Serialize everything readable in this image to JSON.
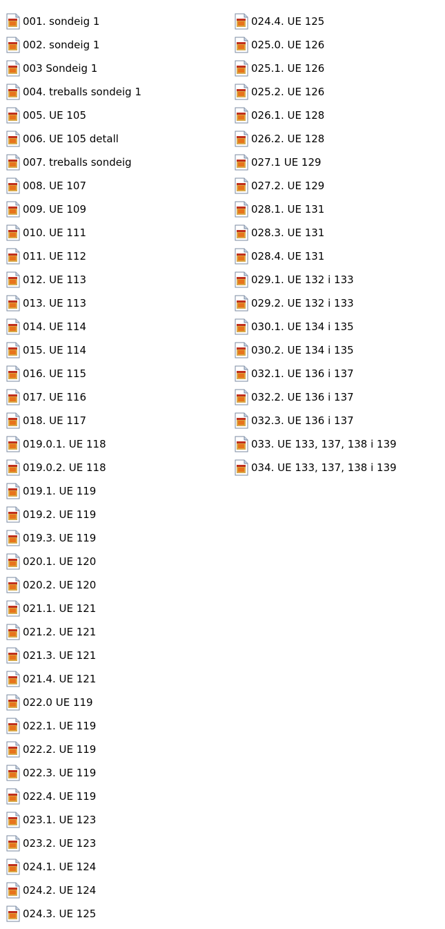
{
  "file_icon": "presentation-file-icon",
  "colors": {
    "background": "#ffffff",
    "text": "#000000",
    "icon_page": "#ffffff",
    "icon_border": "#7a8aa0",
    "icon_fold": "#c8d4e4",
    "icon_orange": "#e8741c",
    "icon_red": "#c0301c",
    "icon_tan": "#d8a848"
  },
  "columns": [
    {
      "items": [
        "001. sondeig 1",
        "002. sondeig 1",
        "003 Sondeig 1",
        "004. treballs sondeig 1",
        "005. UE 105",
        "006. UE 105 detall",
        "007. treballs sondeig",
        "008. UE 107",
        "009. UE 109",
        "010. UE 111",
        "011. UE 112",
        "012. UE 113",
        "013. UE 113",
        "014. UE 114",
        "015. UE 114",
        "016. UE 115",
        "017. UE 116",
        "018. UE 117",
        "019.0.1. UE 118",
        "019.0.2. UE 118",
        "019.1. UE 119",
        "019.2. UE 119",
        "019.3. UE 119",
        "020.1. UE 120",
        "020.2. UE 120",
        "021.1. UE 121",
        "021.2. UE 121",
        "021.3. UE 121",
        "021.4. UE 121",
        "022.0 UE 119",
        "022.1. UE 119",
        "022.2. UE 119",
        "022.3. UE 119",
        "022.4. UE 119",
        "023.1. UE 123",
        "023.2. UE 123",
        "024.1. UE 124",
        "024.2. UE 124",
        "024.3. UE 125"
      ]
    },
    {
      "items": [
        "024.4. UE 125",
        "025.0. UE 126",
        "025.1. UE 126",
        "025.2. UE 126",
        "026.1. UE 128",
        "026.2. UE 128",
        "027.1 UE 129",
        "027.2. UE 129",
        "028.1. UE 131",
        "028.3. UE 131",
        "028.4. UE 131",
        "029.1. UE 132 i 133",
        "029.2. UE 132 i 133",
        "030.1. UE 134 i 135",
        "030.2. UE 134 i 135",
        "032.1. UE 136 i 137",
        "032.2. UE 136 i 137",
        "032.3. UE 136 i 137",
        "033. UE 133, 137, 138 i 139",
        "034. UE 133, 137, 138 i 139"
      ]
    }
  ]
}
